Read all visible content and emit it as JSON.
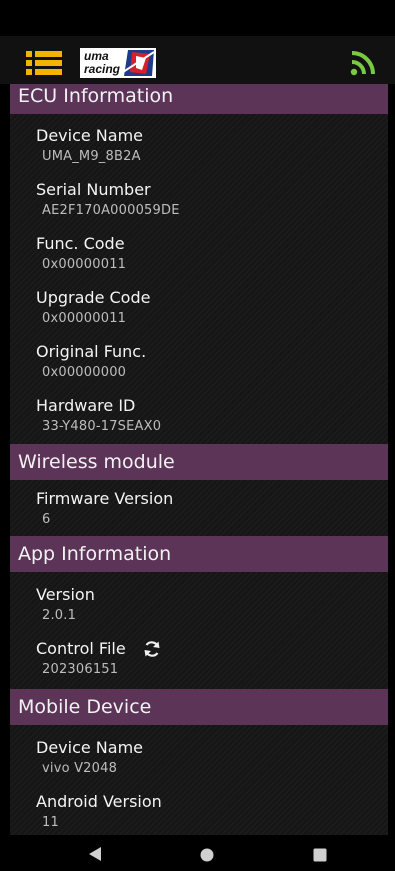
{
  "header": {
    "menu_icon": "hamburger-menu-icon",
    "logo_text_top": "uma",
    "logo_text_bottom": "racing",
    "connection_icon": "rss-connection-icon",
    "accent_color": "#f2b400",
    "connection_color": "#7ac943"
  },
  "sections": [
    {
      "title": "ECU Information",
      "items": [
        {
          "label": "Device Name",
          "value": "UMA_M9_8B2A"
        },
        {
          "label": "Serial Number",
          "value": "AE2F170A000059DE"
        },
        {
          "label": "Func. Code",
          "value": "0x00000011"
        },
        {
          "label": "Upgrade Code",
          "value": "0x00000011"
        },
        {
          "label": "Original Func.",
          "value": "0x00000000"
        },
        {
          "label": "Hardware ID",
          "value": "33-Y480-17SEAX0"
        }
      ]
    },
    {
      "title": "Wireless module",
      "items": [
        {
          "label": "Firmware Version",
          "value": "6"
        }
      ]
    },
    {
      "title": "App Information",
      "items": [
        {
          "label": "Version",
          "value": "2.0.1"
        },
        {
          "label": "Control File",
          "value": "202306151",
          "icon": "refresh-icon"
        }
      ]
    },
    {
      "title": "Mobile Device",
      "items": [
        {
          "label": "Device Name",
          "value": "vivo V2048"
        },
        {
          "label": "Android Version",
          "value": "11"
        }
      ]
    }
  ],
  "nav": {
    "back_icon": "back-triangle-icon",
    "home_icon": "home-circle-icon",
    "recent_icon": "recent-apps-square-icon"
  },
  "colors": {
    "section_header": "#5b3458",
    "background": "#161616"
  }
}
